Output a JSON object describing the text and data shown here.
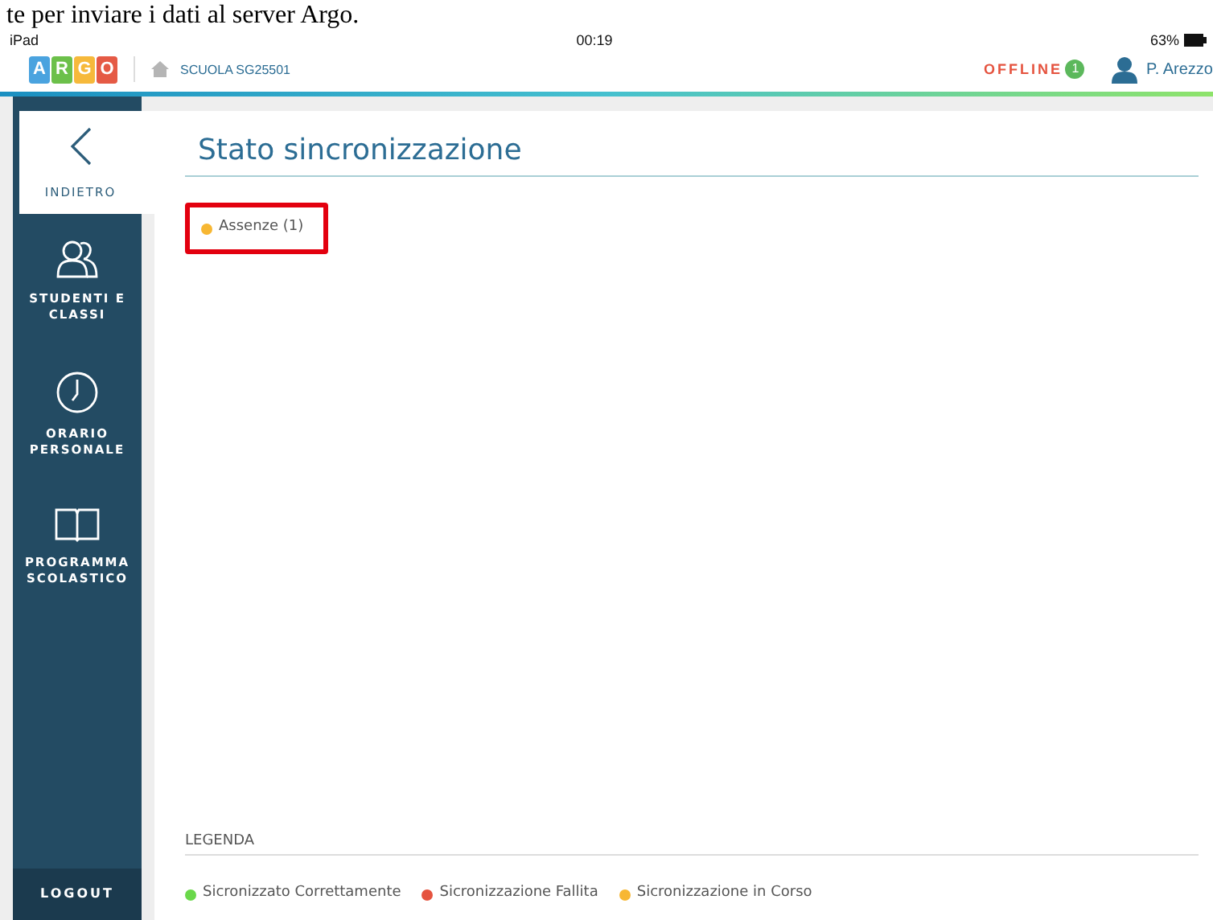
{
  "caption": "te per inviare i dati al server Argo.",
  "status_bar": {
    "device": "iPad",
    "time": "00:19",
    "battery": "63%"
  },
  "header": {
    "logo_letters": [
      "A",
      "R",
      "G",
      "O"
    ],
    "school": "SCUOLA SG25501",
    "connection": "OFFLINE",
    "pending_count": "1",
    "user": "P. Arezzo"
  },
  "sidebar": {
    "items": [
      {
        "label": "INDIETRO",
        "kind": "back",
        "selected": true
      },
      {
        "label": "STUDENTI E CLASSI",
        "kind": "students",
        "selected": false
      },
      {
        "label": "ORARIO PERSONALE",
        "kind": "clock",
        "selected": false
      },
      {
        "label": "PROGRAMMA SCOLASTICO",
        "kind": "book",
        "selected": false
      }
    ],
    "logout": "LOGOUT"
  },
  "page": {
    "title": "Stato sincronizzazione",
    "sync_items": [
      {
        "label": "Assenze (1)",
        "color": "#f7b733",
        "highlighted": true
      }
    ],
    "legend": {
      "title": "LEGENDA",
      "items": [
        {
          "label": "Sicronizzato Correttamente",
          "color": "#6ad84a"
        },
        {
          "label": "Sicronizzazione Fallita",
          "color": "#e5533f"
        },
        {
          "label": "Sicronizzazione in Corso",
          "color": "#f7b733"
        }
      ]
    }
  }
}
